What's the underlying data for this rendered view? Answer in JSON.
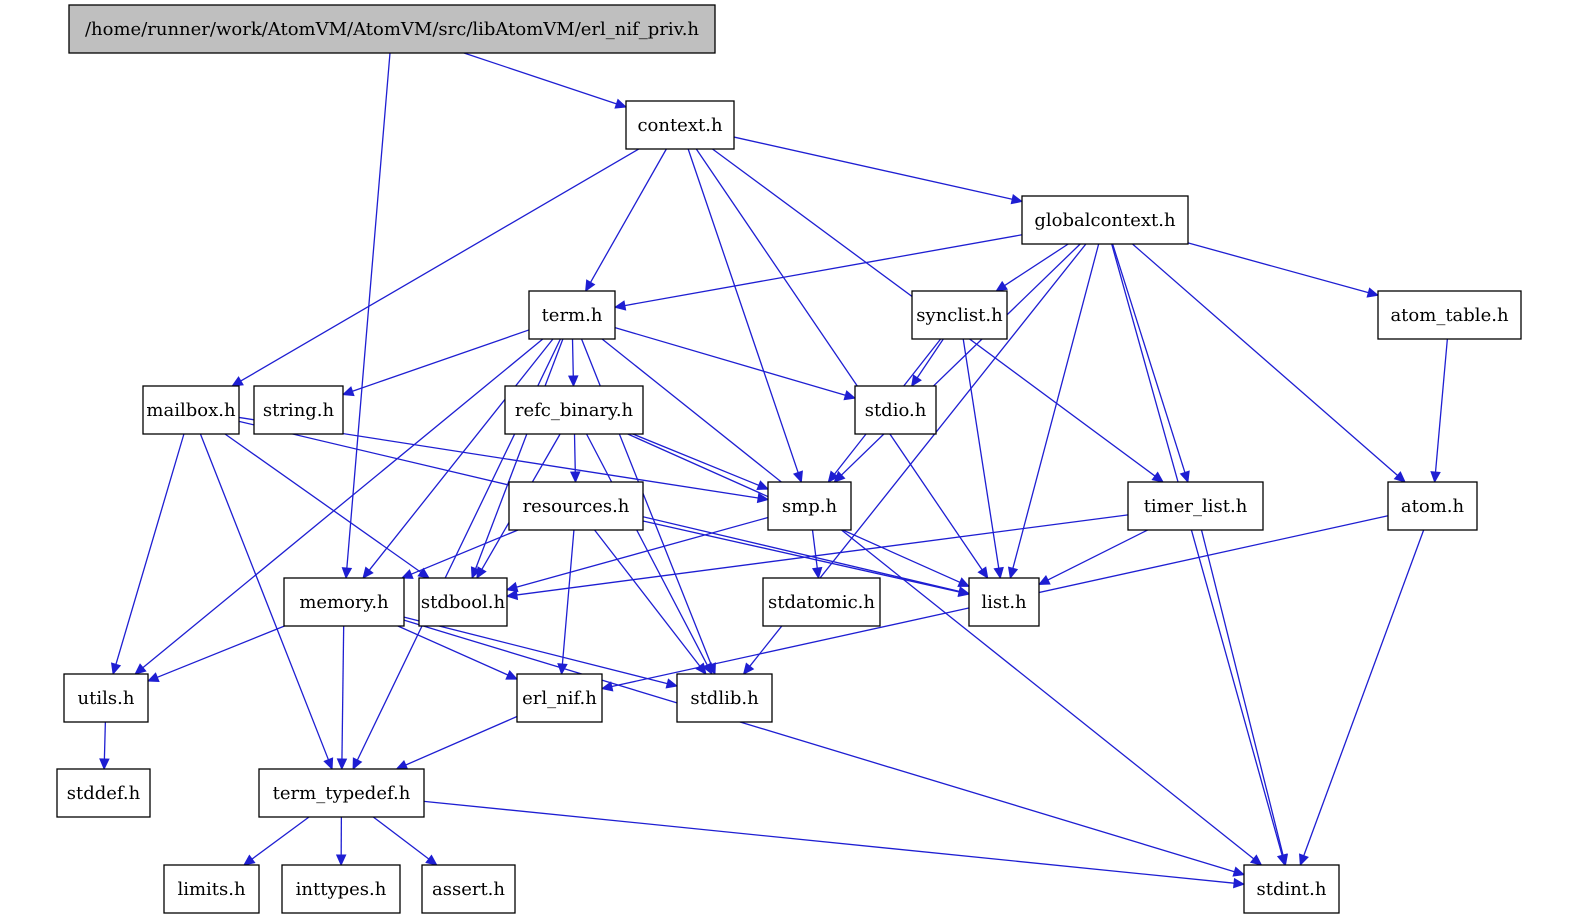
{
  "graph": {
    "type": "include-dependency-graph",
    "colors": {
      "edge": "#1e1ed2",
      "root_fill": "#bfbfbf",
      "node_fill": "#ffffff",
      "border": "#000000"
    },
    "nodes": [
      {
        "id": "root",
        "label": "/home/runner/work/AtomVM/AtomVM/src/libAtomVM/erl_nif_priv.h",
        "root": true
      },
      {
        "id": "context",
        "label": "context.h"
      },
      {
        "id": "globalcontext",
        "label": "globalcontext.h"
      },
      {
        "id": "term",
        "label": "term.h"
      },
      {
        "id": "synclist",
        "label": "synclist.h"
      },
      {
        "id": "atom_table",
        "label": "atom_table.h"
      },
      {
        "id": "mailbox",
        "label": "mailbox.h"
      },
      {
        "id": "string",
        "label": "string.h"
      },
      {
        "id": "refc_binary",
        "label": "refc_binary.h"
      },
      {
        "id": "stdio",
        "label": "stdio.h"
      },
      {
        "id": "resources",
        "label": "resources.h"
      },
      {
        "id": "smp",
        "label": "smp.h"
      },
      {
        "id": "timer_list",
        "label": "timer_list.h"
      },
      {
        "id": "atom",
        "label": "atom.h"
      },
      {
        "id": "memory",
        "label": "memory.h"
      },
      {
        "id": "stdbool",
        "label": "stdbool.h"
      },
      {
        "id": "stdatomic",
        "label": "stdatomic.h"
      },
      {
        "id": "list",
        "label": "list.h"
      },
      {
        "id": "utils",
        "label": "utils.h"
      },
      {
        "id": "erl_nif",
        "label": "erl_nif.h"
      },
      {
        "id": "stdlib",
        "label": "stdlib.h"
      },
      {
        "id": "stddef",
        "label": "stddef.h"
      },
      {
        "id": "term_typedef",
        "label": "term_typedef.h"
      },
      {
        "id": "limits",
        "label": "limits.h"
      },
      {
        "id": "inttypes",
        "label": "inttypes.h"
      },
      {
        "id": "assert",
        "label": "assert.h"
      },
      {
        "id": "stdint",
        "label": "stdint.h"
      }
    ],
    "edges": [
      [
        "root",
        "context"
      ],
      [
        "root",
        "memory"
      ],
      [
        "context",
        "globalcontext"
      ],
      [
        "context",
        "term"
      ],
      [
        "context",
        "mailbox"
      ],
      [
        "context",
        "smp"
      ],
      [
        "context",
        "timer_list"
      ],
      [
        "context",
        "list"
      ],
      [
        "globalcontext",
        "term"
      ],
      [
        "globalcontext",
        "synclist"
      ],
      [
        "globalcontext",
        "atom_table"
      ],
      [
        "globalcontext",
        "atom"
      ],
      [
        "globalcontext",
        "smp"
      ],
      [
        "globalcontext",
        "timer_list"
      ],
      [
        "globalcontext",
        "list"
      ],
      [
        "globalcontext",
        "stdlib"
      ],
      [
        "globalcontext",
        "stdint"
      ],
      [
        "term",
        "string"
      ],
      [
        "term",
        "refc_binary"
      ],
      [
        "term",
        "stdio"
      ],
      [
        "term",
        "memory"
      ],
      [
        "term",
        "stdbool"
      ],
      [
        "term",
        "utils"
      ],
      [
        "term",
        "term_typedef"
      ],
      [
        "term",
        "stdlib"
      ],
      [
        "term",
        "stdint"
      ],
      [
        "synclist",
        "stdio"
      ],
      [
        "synclist",
        "smp"
      ],
      [
        "synclist",
        "list"
      ],
      [
        "atom_table",
        "atom"
      ],
      [
        "mailbox",
        "smp"
      ],
      [
        "mailbox",
        "list"
      ],
      [
        "mailbox",
        "stdbool"
      ],
      [
        "mailbox",
        "utils"
      ],
      [
        "mailbox",
        "term_typedef"
      ],
      [
        "refc_binary",
        "resources"
      ],
      [
        "refc_binary",
        "smp"
      ],
      [
        "refc_binary",
        "stdbool"
      ],
      [
        "refc_binary",
        "stdlib"
      ],
      [
        "refc_binary",
        "list"
      ],
      [
        "resources",
        "memory"
      ],
      [
        "resources",
        "erl_nif"
      ],
      [
        "resources",
        "stdlib"
      ],
      [
        "resources",
        "list"
      ],
      [
        "smp",
        "stdbool"
      ],
      [
        "smp",
        "stdatomic"
      ],
      [
        "timer_list",
        "stdbool"
      ],
      [
        "timer_list",
        "list"
      ],
      [
        "timer_list",
        "stdint"
      ],
      [
        "atom",
        "erl_nif"
      ],
      [
        "atom",
        "stdint"
      ],
      [
        "memory",
        "utils"
      ],
      [
        "memory",
        "term_typedef"
      ],
      [
        "memory",
        "erl_nif"
      ],
      [
        "memory",
        "stdlib"
      ],
      [
        "memory",
        "stdint"
      ],
      [
        "utils",
        "stddef"
      ],
      [
        "erl_nif",
        "term_typedef"
      ],
      [
        "term_typedef",
        "limits"
      ],
      [
        "term_typedef",
        "inttypes"
      ],
      [
        "term_typedef",
        "assert"
      ],
      [
        "term_typedef",
        "stdint"
      ]
    ]
  }
}
